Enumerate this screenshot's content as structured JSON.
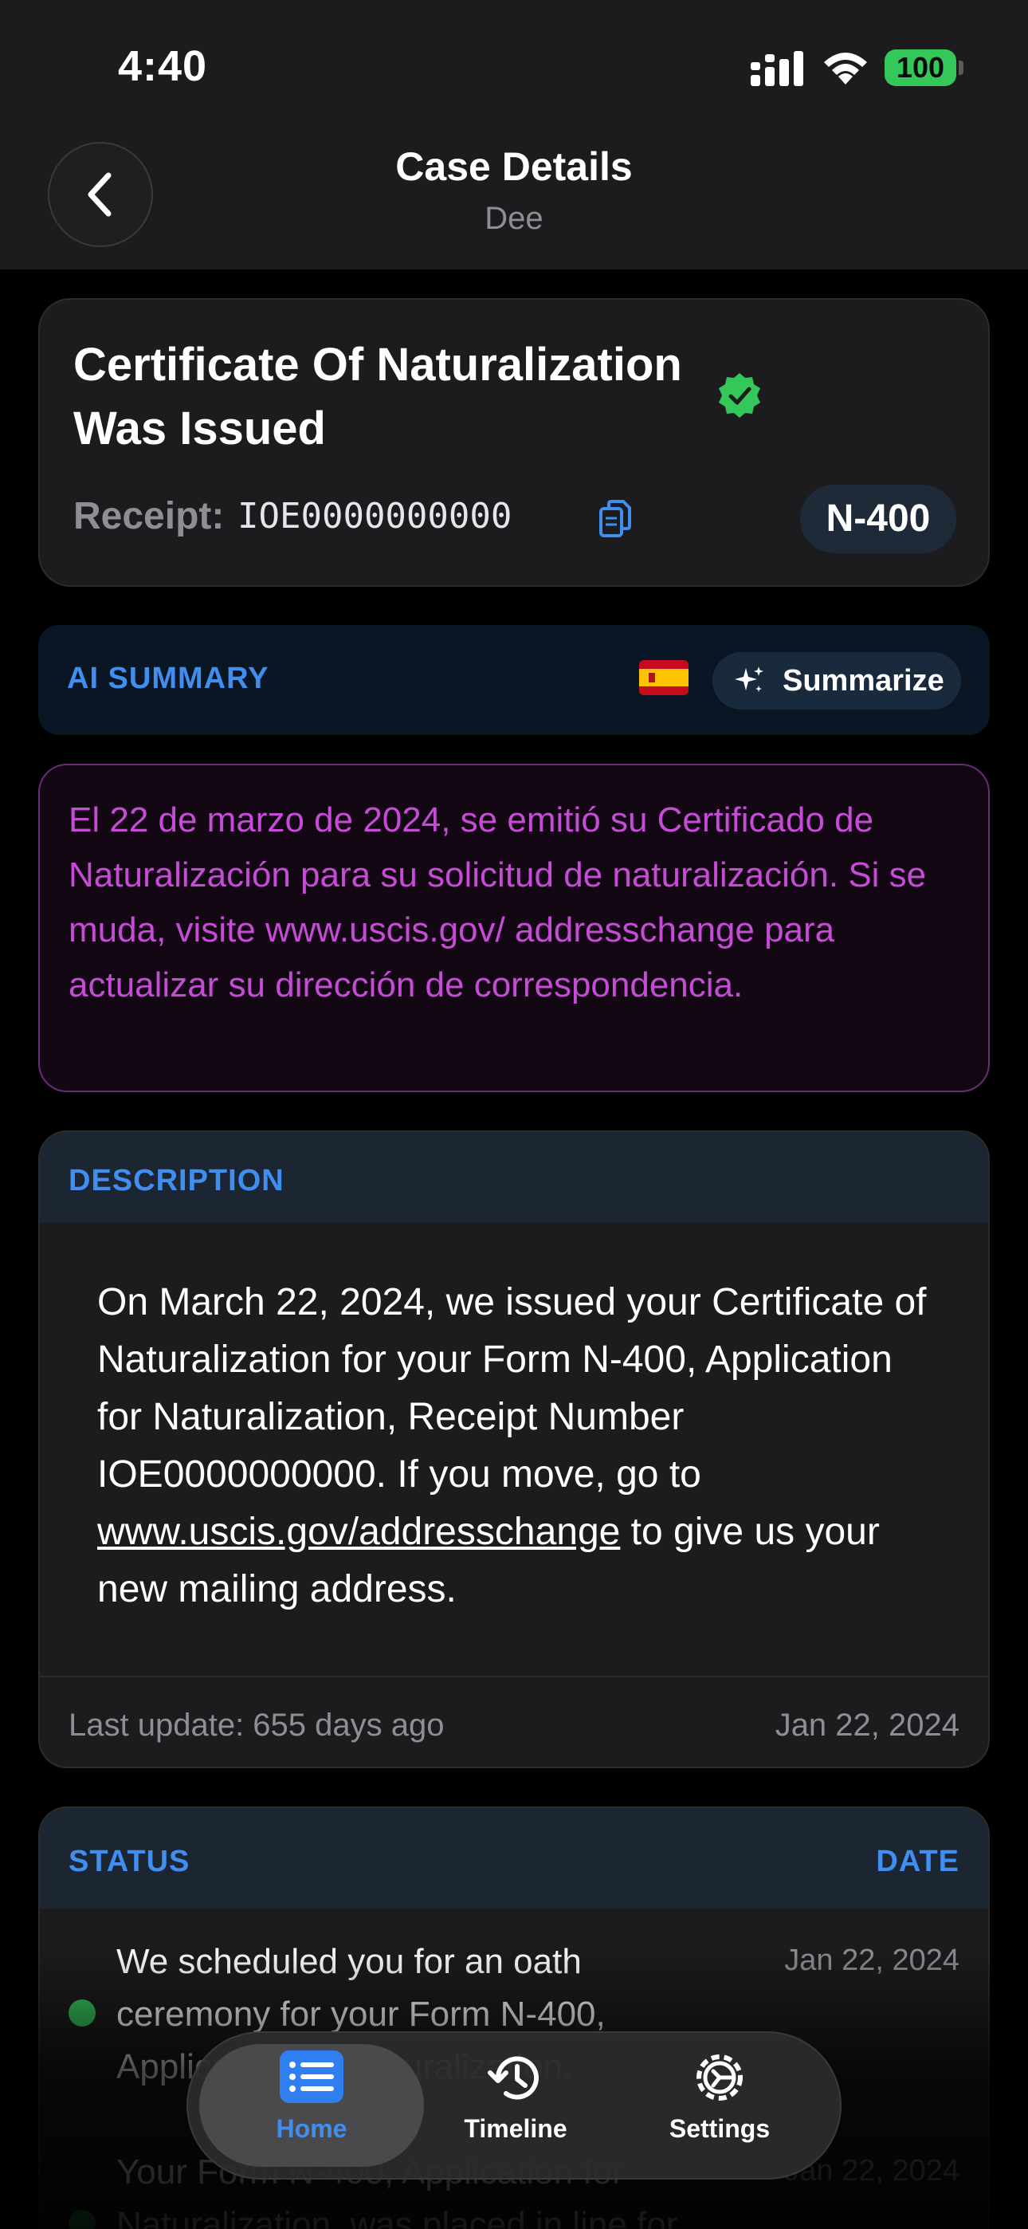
{
  "status_bar": {
    "time": "4:40",
    "battery": "100"
  },
  "header": {
    "title": "Case Details",
    "subtitle": "Dee",
    "back_icon": "chevron-left-icon"
  },
  "case": {
    "title": "Certificate Of Naturalization Was Issued",
    "receipt_label": "Receipt:",
    "receipt_number": "IOE0000000000",
    "form_type": "N-400",
    "verified_color": "#34c759"
  },
  "ai_summary": {
    "label": "AI SUMMARY",
    "language_flag": "spain-flag-icon",
    "summarize_label": "Summarize",
    "text": "El 22 de marzo de 2024, se emitió su Certificado de Naturalización para su solicitud de naturalización. Si se muda, visite www.uscis.gov/ addresschange para actualizar su dirección de correspondencia."
  },
  "description": {
    "label": "DESCRIPTION",
    "text_before": "On March 22, 2024, we issued your Certificate of Naturalization for your Form N-400, Application for Naturalization, Receipt Number IOE0000000000. If you move, go to ",
    "link": "www.uscis.gov/addresschange",
    "text_after": " to give us your new mailing address.",
    "last_update": "Last update: 655 days ago",
    "date": "Jan 22, 2024"
  },
  "status": {
    "header_left": "STATUS",
    "header_right": "DATE",
    "items": [
      {
        "text": "We scheduled you for an oath ceremony for your Form N-400, Application for Naturalization.",
        "date": "Jan 22, 2024"
      },
      {
        "text": "Your Form N-400, Application for Naturalization, was placed in line for",
        "date": "Jan 22, 2024"
      }
    ]
  },
  "tabs": [
    {
      "label": "Home",
      "icon": "list-icon",
      "active": true
    },
    {
      "label": "Timeline",
      "icon": "history-icon",
      "active": false
    },
    {
      "label": "Settings",
      "icon": "gear-icon",
      "active": false
    }
  ],
  "colors": {
    "accent": "#3f8ef0",
    "ai_text": "#c64bd6",
    "success": "#34c759"
  }
}
